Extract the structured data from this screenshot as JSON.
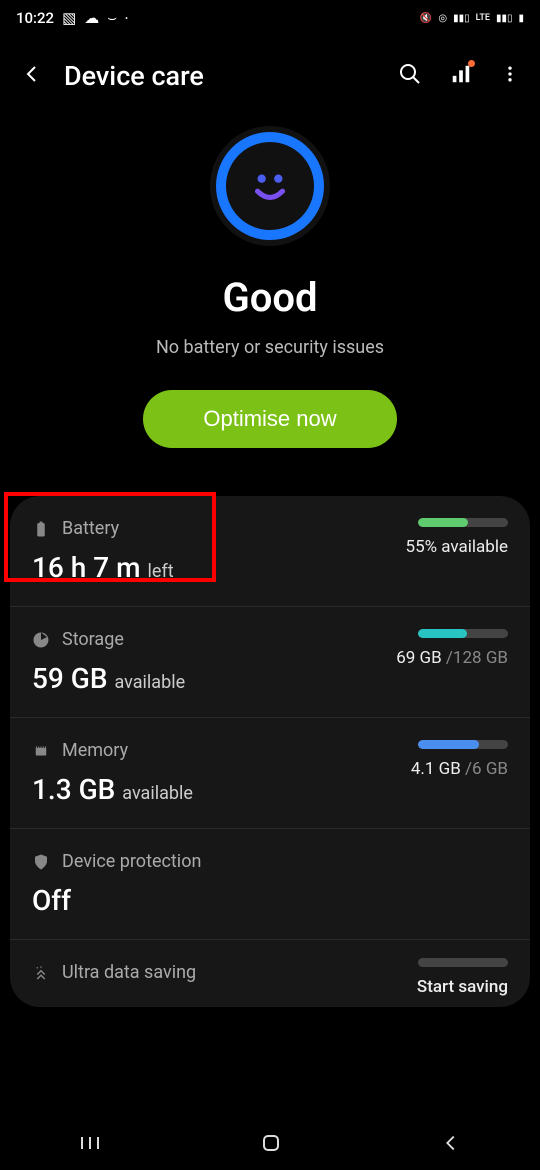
{
  "statusBar": {
    "time": "10:22",
    "indicators": "LTE"
  },
  "header": {
    "title": "Device care"
  },
  "status": {
    "title": "Good",
    "subtitle": "No battery or security issues",
    "button": "Optimise now"
  },
  "rows": {
    "battery": {
      "label": "Battery",
      "main": "16 h 7 m",
      "mainSuffix": "left",
      "right": "55% available"
    },
    "storage": {
      "label": "Storage",
      "main": "59 GB",
      "mainSuffix": "available",
      "rightUsed": "69 GB",
      "rightTotal": "/128 GB"
    },
    "memory": {
      "label": "Memory",
      "main": "1.3 GB",
      "mainSuffix": "available",
      "rightUsed": "4.1 GB",
      "rightTotal": "/6 GB"
    },
    "protection": {
      "label": "Device protection",
      "main": "Off"
    },
    "ultra": {
      "label": "Ultra data saving",
      "right": "Start saving"
    }
  }
}
